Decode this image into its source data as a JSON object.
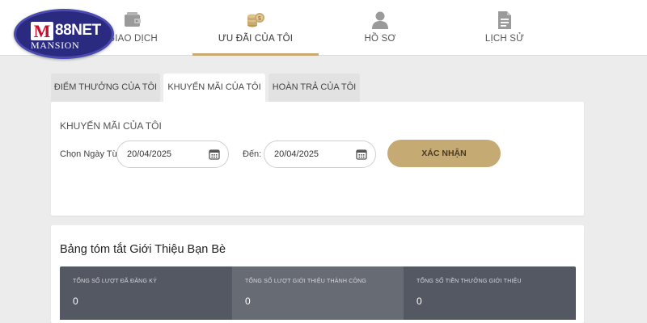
{
  "logo": {
    "mark": "M",
    "brand": "88NET",
    "subtitle": "MANSION"
  },
  "nav": {
    "items": [
      {
        "label": "GIAO DỊCH",
        "icon": "wallet-icon"
      },
      {
        "label": "ƯU ĐÃI CỦA TÔI",
        "icon": "coins-icon",
        "active": true
      },
      {
        "label": "HỒ SƠ",
        "icon": "user-icon"
      },
      {
        "label": "LỊCH SỬ",
        "icon": "document-icon"
      }
    ]
  },
  "tabs": [
    {
      "label": "ĐIỂM THƯỞNG CỦA TÔI"
    },
    {
      "label": "KHUYẾN MÃI CỦA TÔI",
      "active": true
    },
    {
      "label": "HOÀN TRẢ CỦA TÔI"
    }
  ],
  "promo": {
    "title": "KHUYẾN MÃI CỦA TÔI",
    "from_label": "Chọn Ngày Từ:",
    "from_value": "20/04/2025",
    "to_label": "Đến:",
    "to_value": "20/04/2025",
    "confirm_label": "XÁC NHẬN"
  },
  "summary": {
    "title": "Bảng tóm tắt Giới Thiệu Bạn Bè",
    "stats": [
      {
        "label": "TỔNG SỐ LƯỢT ĐÃ ĐĂNG KÝ",
        "value": "0"
      },
      {
        "label": "TỔNG SỐ LƯỢT GIỚI THIỆU THÀNH CÔNG",
        "value": "0"
      },
      {
        "label": "TỔNG SỐ TIỀN THƯỞNG GIỚI THIỆU",
        "value": "0"
      }
    ]
  },
  "colors": {
    "accent": "#c9aa6e",
    "button": "#c6aa74",
    "logo_bg": "#2a2a80",
    "stat_dark": "#545862",
    "stat_light": "#676b74"
  }
}
